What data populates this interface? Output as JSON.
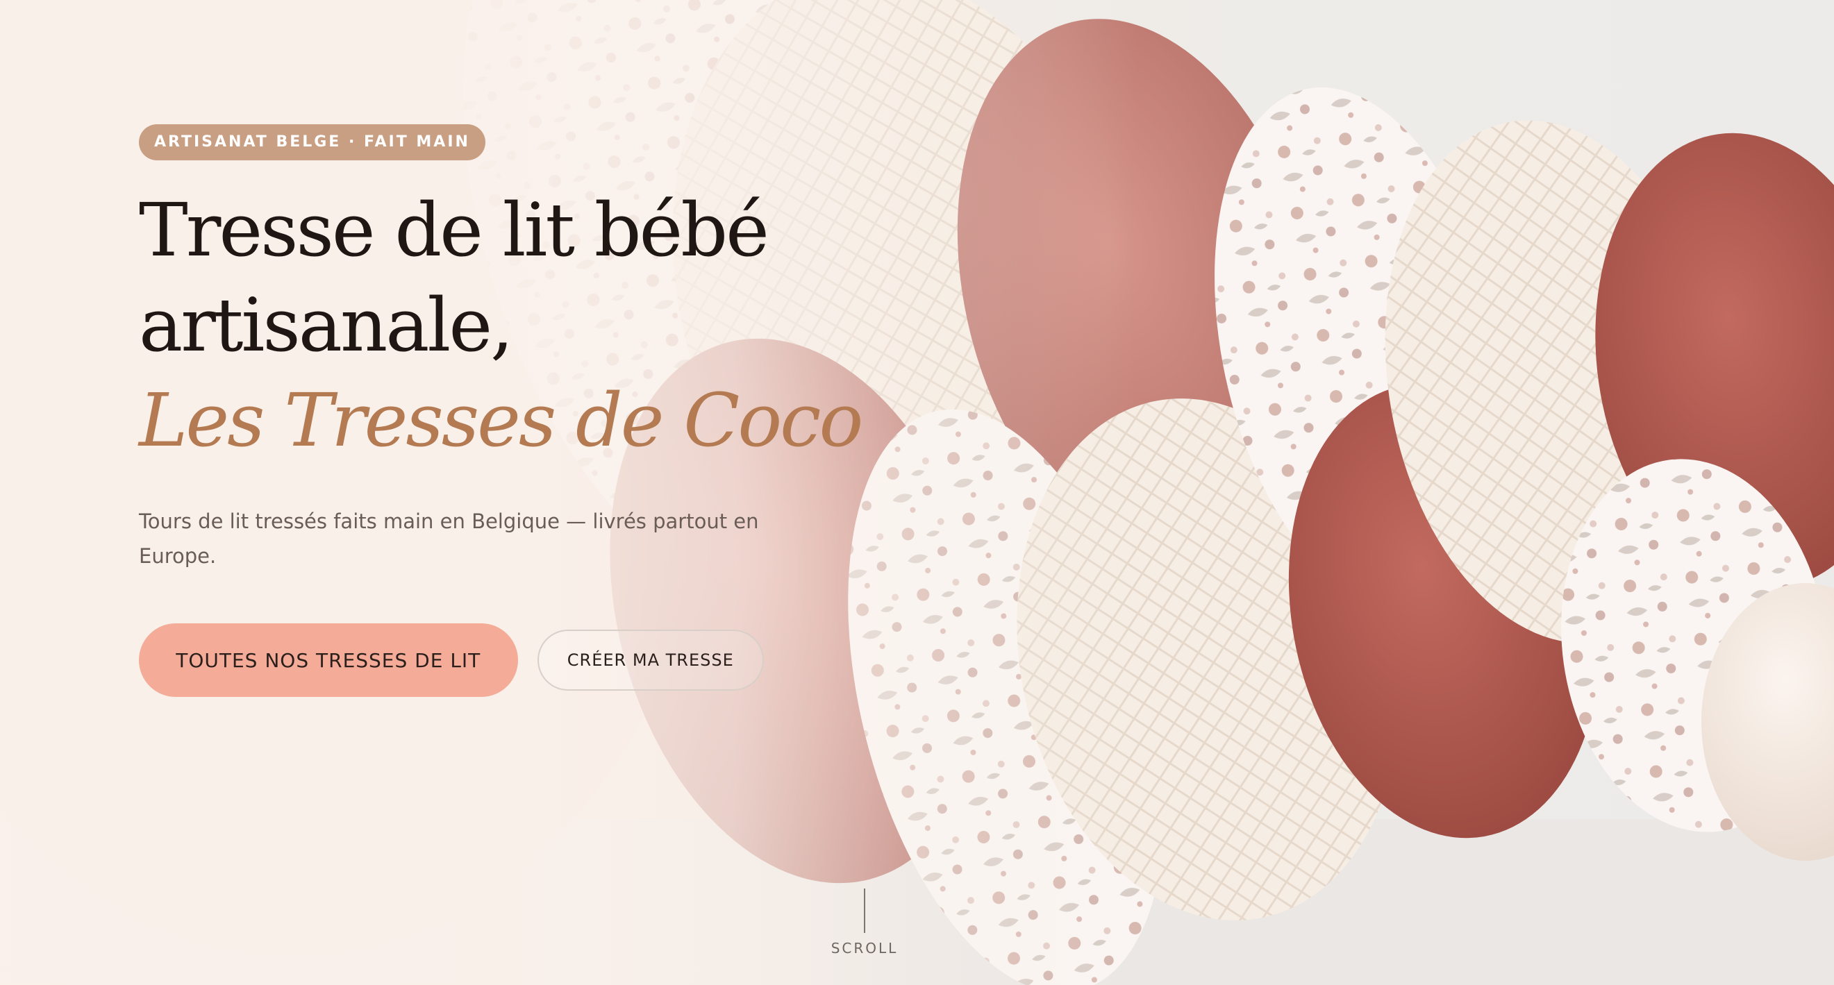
{
  "hero": {
    "badge": "ARTISANAT BELGE · FAIT MAIN",
    "title_line1": "Tresse de lit bébé",
    "title_line2": "artisanale,",
    "title_accent": "Les Tresses de Coco",
    "subtitle": "Tours de lit tressés faits main en Belgique — livrés partout en Europe.",
    "primary_button": "TOUTES NOS TRESSES DE LIT",
    "secondary_button": "CRÉER MA TRESSE",
    "scroll_label": "SCROLL"
  },
  "colors": {
    "badge_bg": "#c99f83",
    "accent_text": "#b47a52",
    "primary_button_bg": "#f4ab98",
    "braid_pink": "#c9857d",
    "braid_rust": "#b0594e",
    "braid_cream": "#f5ece3",
    "braid_floral": "#f8f2ee"
  },
  "background_image": {
    "subject": "braided crib bumper in floral, waffle-knit cream and pink/rust velvet fabrics"
  }
}
